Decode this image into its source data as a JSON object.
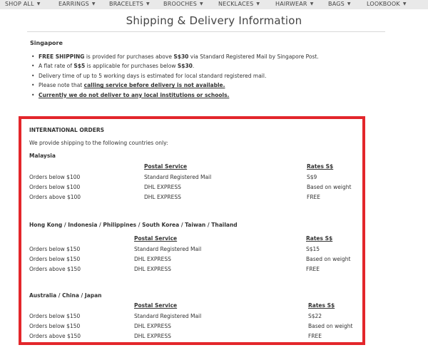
{
  "nav": {
    "items": [
      {
        "label": "SHOP ALL",
        "icon": "chevron-down-icon"
      },
      {
        "label": "EARRINGS",
        "icon": "chevron-down-icon"
      },
      {
        "label": "BRACELETS",
        "icon": "chevron-down-icon"
      },
      {
        "label": "BROOCHES",
        "icon": "chevron-down-icon"
      },
      {
        "label": "NECKLACES",
        "icon": "chevron-down-icon"
      },
      {
        "label": "HAIRWEAR",
        "icon": "chevron-down-icon"
      },
      {
        "label": "BAGS",
        "icon": "chevron-down-icon"
      },
      {
        "label": "LOOKBOOK",
        "icon": "chevron-down-icon"
      }
    ]
  },
  "page": {
    "title": "Shipping & Delivery Information"
  },
  "singapore": {
    "heading": "Singapore",
    "li1": {
      "a": "FREE SHIPPING",
      "b": " is provided for purchases above ",
      "c": "S$30",
      "d": " via Standard Registered Mail by Singapore Post."
    },
    "li2": {
      "a": "A flat rate of ",
      "b": "S$5",
      "c": " is applicable for purchases below ",
      "d": "S$30",
      "e": "."
    },
    "li3": "Delivery time of up to 5 working days is estimated for local standard registered mail.",
    "li4": {
      "a": "Please note that ",
      "b": "calling service before delivery is not available."
    },
    "li5": "Currently we do not deliver to any local institutions or schools."
  },
  "international": {
    "heading": "INTERNATIONAL ORDERS",
    "intro": "We provide shipping to the following countries only:",
    "column_service": "Postal Service",
    "column_rates": "Rates S$",
    "sections": [
      {
        "title": "Malaysia",
        "rows": [
          {
            "condition": "Orders below $100",
            "service": "Standard Registered Mail",
            "rate": "S$9"
          },
          {
            "condition": "Orders below $100",
            "service": "DHL EXPRESS",
            "rate": "Based on weight"
          },
          {
            "condition": "Orders above $100",
            "service": "DHL EXPRESS",
            "rate": "FREE"
          }
        ]
      },
      {
        "title": "Hong Kong / Indonesia / Philippines / South Korea / Taiwan / Thailand",
        "rows": [
          {
            "condition": "Orders below $150",
            "service": "Standard Registered Mail",
            "rate": "S$15"
          },
          {
            "condition": "Orders below $150",
            "service": "DHL EXPRESS",
            "rate": "Based on weight"
          },
          {
            "condition": "Orders above $150",
            "service": "DHL EXPRESS",
            "rate": "FREE"
          }
        ]
      },
      {
        "title": "Australia / China / Japan",
        "rows": [
          {
            "condition": "Orders below $150",
            "service": "Standard Registered Mail",
            "rate": "S$22"
          },
          {
            "condition": "Orders below $150",
            "service": "DHL EXPRESS",
            "rate": "Based on weight"
          },
          {
            "condition": "Orders above $150",
            "service": "DHL EXPRESS",
            "rate": "FREE"
          }
        ]
      }
    ]
  },
  "colors": {
    "nav_bg": "#e9e9e9",
    "highlight_border": "#e3262b",
    "text": "#333333"
  }
}
